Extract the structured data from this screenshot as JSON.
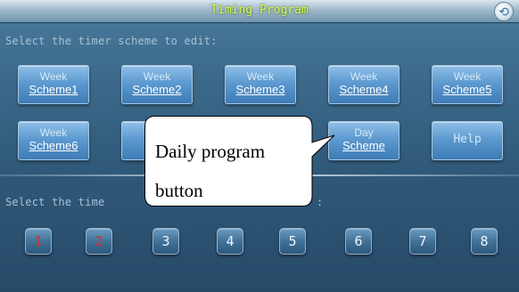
{
  "title": "Timing Program",
  "back_icon": "back-arrow-icon",
  "back_glyph": "⟲",
  "instruction_top": "Select the timer scheme to edit:",
  "scheme_buttons": [
    {
      "line1": "Week",
      "line2": "Scheme1"
    },
    {
      "line1": "Week",
      "line2": "Scheme2"
    },
    {
      "line1": "Week",
      "line2": "Scheme3"
    },
    {
      "line1": "Week",
      "line2": "Scheme4"
    },
    {
      "line1": "Week",
      "line2": "Scheme5"
    },
    {
      "line1": "Week",
      "line2": "Scheme6"
    },
    {
      "line1": "",
      "line2": "Sc"
    },
    {
      "line1": "",
      "line2": ""
    },
    {
      "line1": "Day",
      "line2": "Scheme"
    },
    {
      "line1": "Help",
      "line2": ""
    }
  ],
  "instruction_bottom_start": "Select the time",
  "instruction_bottom_end": ":",
  "timer_buttons": [
    "1",
    "2",
    "3",
    "4",
    "5",
    "6",
    "7",
    "8"
  ],
  "callout": {
    "line1": "Daily program",
    "line2": "button"
  },
  "colors": {
    "title_text": "#d9ff4a",
    "button_blue": "#5d9ad0",
    "inactive_number": "#c93434"
  }
}
